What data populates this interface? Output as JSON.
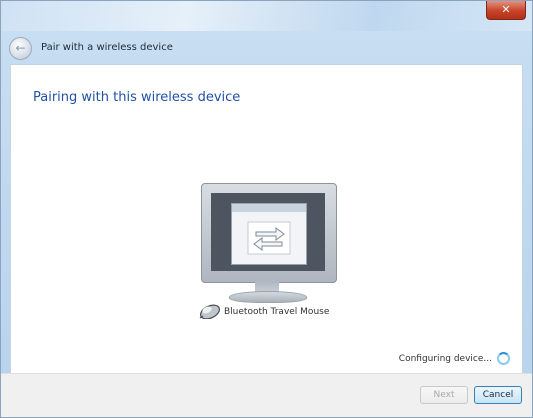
{
  "titlebar": {
    "close_label": "✕"
  },
  "wizard": {
    "back_glyph": "←",
    "title": "Pair with a wireless device",
    "heading": "Pairing with this wireless device"
  },
  "device": {
    "name": "Bluetooth Travel Mouse",
    "icon": "mouse-icon"
  },
  "status": {
    "text": "Configuring device...",
    "icon": "spinner-icon"
  },
  "buttons": {
    "next": "Next",
    "cancel": "Cancel"
  },
  "colors": {
    "heading": "#2250a8",
    "close_button": "#c7432a",
    "spinner": "#2a8fd6"
  }
}
